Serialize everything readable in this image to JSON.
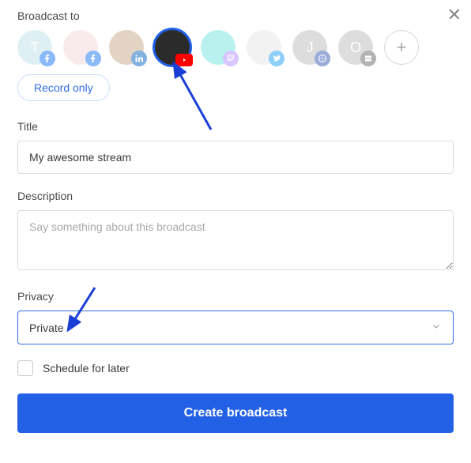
{
  "header": {
    "label": "Broadcast to"
  },
  "destinations": [
    {
      "name": "dest-t-facebook",
      "letter": "T",
      "bg": "#bfe3ea",
      "badge": "facebook",
      "badge_bg": "#1877f2",
      "faded": true,
      "selected": false
    },
    {
      "name": "dest-fb2",
      "letter": "",
      "bg": "#f5d9d9",
      "badge": "facebook",
      "badge_bg": "#1877f2",
      "faded": true,
      "selected": false
    },
    {
      "name": "dest-linkedin",
      "letter": "",
      "bg": "#c9a98a",
      "badge": "linkedin",
      "badge_bg": "#0a66c2",
      "faded": true,
      "selected": false
    },
    {
      "name": "dest-youtube",
      "letter": "",
      "bg": "#2b2b2b",
      "badge": "youtube",
      "badge_bg": "#ff0000",
      "faded": false,
      "selected": true
    },
    {
      "name": "dest-twitch",
      "letter": "",
      "bg": "#75e5e0",
      "badge": "twitch",
      "badge_bg": "#b58cff",
      "faded": true,
      "selected": false
    },
    {
      "name": "dest-twitter",
      "letter": "",
      "bg": "#e6e6e6",
      "badge": "twitter",
      "badge_bg": "#1da1f2",
      "faded": true,
      "selected": false
    },
    {
      "name": "dest-j",
      "letter": "J",
      "bg": "#bcbcbc",
      "badge": "generic",
      "badge_bg": "#3b5bb5",
      "faded": true,
      "selected": false
    },
    {
      "name": "dest-o",
      "letter": "O",
      "bg": "#bcbcbc",
      "badge": "server",
      "badge_bg": "#6a6a6a",
      "faded": true,
      "selected": false
    }
  ],
  "record_only_label": "Record only",
  "title": {
    "label": "Title",
    "value": "My awesome stream"
  },
  "description": {
    "label": "Description",
    "placeholder": "Say something about this broadcast"
  },
  "privacy": {
    "label": "Privacy",
    "value": "Private"
  },
  "schedule": {
    "label": "Schedule for later",
    "checked": false
  },
  "submit_label": "Create broadcast"
}
